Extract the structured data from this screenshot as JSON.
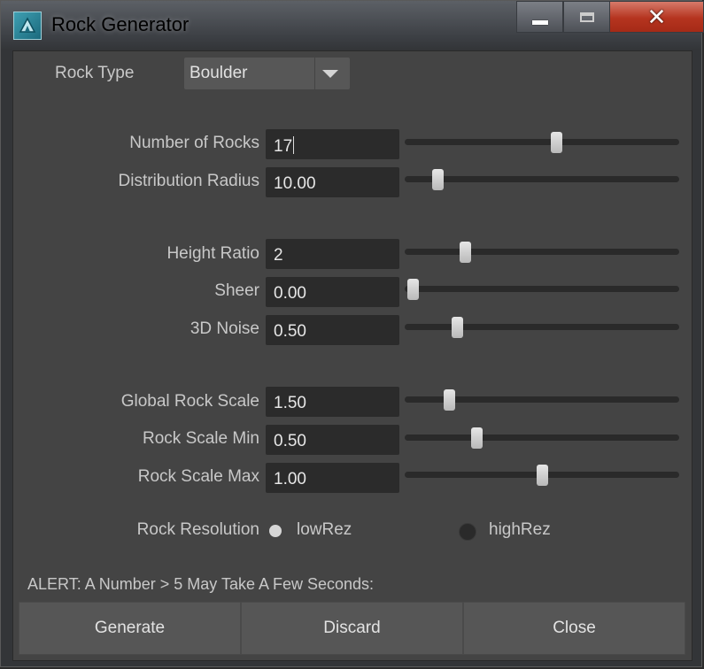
{
  "window": {
    "title": "Rock Generator"
  },
  "rock_type": {
    "label": "Rock Type",
    "value": "Boulder"
  },
  "fields": [
    {
      "label": "Number of Rocks",
      "value": "17",
      "slider": 0.55
    },
    {
      "label": "Distribution Radius",
      "value": "10.00",
      "slider": 0.12
    },
    {
      "label": "Height Ratio",
      "value": "2",
      "slider": 0.22
    },
    {
      "label": "Sheer",
      "value": "0.00",
      "slider": 0.03
    },
    {
      "label": "3D Noise",
      "value": "0.50",
      "slider": 0.19
    },
    {
      "label": "Global Rock Scale",
      "value": "1.50",
      "slider": 0.16
    },
    {
      "label": "Rock Scale Min",
      "value": "0.50",
      "slider": 0.26
    },
    {
      "label": "Rock Scale Max",
      "value": "1.00",
      "slider": 0.5
    }
  ],
  "resolution": {
    "label": "Rock Resolution",
    "options": [
      "lowRez",
      "highRez"
    ],
    "selected": "lowRez"
  },
  "alert": "ALERT: A Number > 5 May Take A Few Seconds:",
  "buttons": {
    "generate": "Generate",
    "discard": "Discard",
    "close": "Close"
  }
}
